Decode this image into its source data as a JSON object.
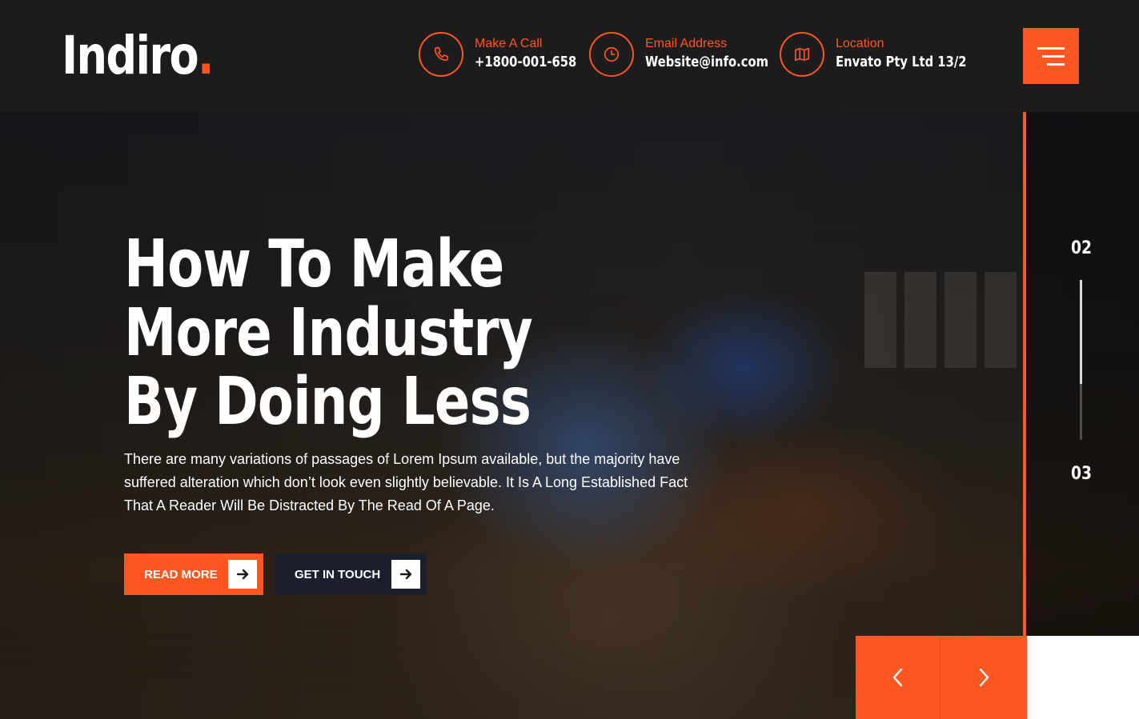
{
  "brand": {
    "name": "Indiro",
    "dot": ".",
    "accent_color": "#ff5722"
  },
  "header": {
    "contacts": [
      {
        "icon": "phone-icon",
        "label": "Make A Call",
        "value": "+1800-001-658"
      },
      {
        "icon": "clock-icon",
        "label": "Email Address",
        "value": "Website@info.com"
      },
      {
        "icon": "map-icon",
        "label": "Location",
        "value": "Envato Pty Ltd 13/2"
      }
    ],
    "menu_icon": "hamburger-menu-icon"
  },
  "hero": {
    "title": "How To Make More Industry By Doing Less",
    "description": "There are many variations of passages of Lorem Ipsum available, but the majority have suffered alteration which don’t look even slightly believable. It Is A Long Established Fact That A Reader Will Be Distracted By The Read Of A Page.",
    "buttons": [
      {
        "label": "READ MORE",
        "icon": "arrow-right-icon",
        "color": "#ff5722"
      },
      {
        "label": "GET IN TOUCH",
        "icon": "arrow-right-icon",
        "color": "#1b1f2e"
      }
    ]
  },
  "slider": {
    "current": "02",
    "next": "03",
    "progress": 0.65,
    "prev_icon": "chevron-left-icon",
    "next_icon": "chevron-right-icon"
  }
}
